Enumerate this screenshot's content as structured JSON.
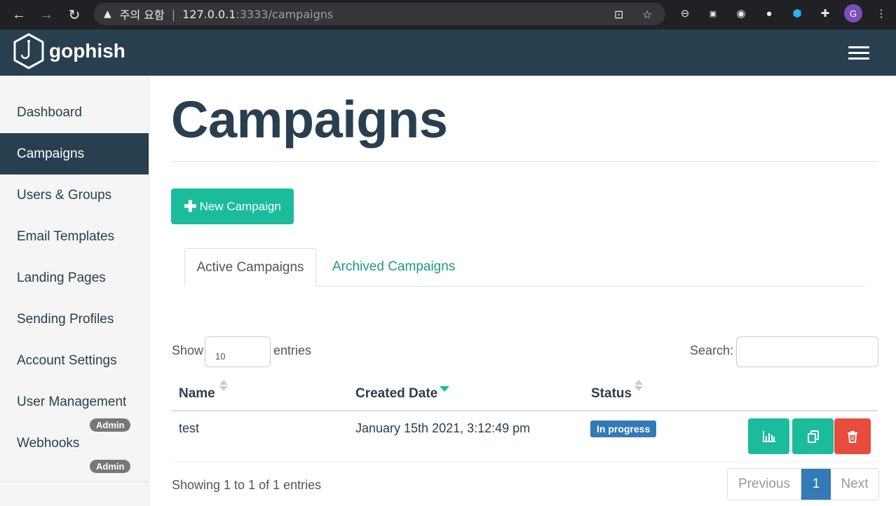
{
  "browser": {
    "security_warning": "주의 요함",
    "url_host": "127.0.0.1",
    "url_path": ":3333/campaigns",
    "profile_initial": "G"
  },
  "app": {
    "brand": "gophish"
  },
  "sidebar": {
    "items": [
      {
        "label": "Dashboard"
      },
      {
        "label": "Campaigns"
      },
      {
        "label": "Users & Groups"
      },
      {
        "label": "Email Templates"
      },
      {
        "label": "Landing Pages"
      },
      {
        "label": "Sending Profiles"
      },
      {
        "label": "Account Settings"
      },
      {
        "label": "User Management"
      },
      {
        "label": "Webhooks"
      }
    ],
    "admin_badge": "Admin"
  },
  "main": {
    "title": "Campaigns",
    "new_button": "New Campaign",
    "tabs": [
      {
        "label": "Active Campaigns"
      },
      {
        "label": "Archived Campaigns"
      }
    ],
    "length": {
      "show": "Show",
      "value": "10",
      "entries": "entries"
    },
    "search_label": "Search:",
    "table": {
      "headers": [
        "Name",
        "Created Date",
        "Status"
      ],
      "rows": [
        {
          "name": "test",
          "created": "January 15th 2021, 3:12:49 pm",
          "status": "In progress"
        }
      ]
    },
    "info": "Showing 1 to 1 of 1 entries",
    "pager": {
      "previous": "Previous",
      "current": "1",
      "next": "Next"
    }
  },
  "colors": {
    "navy": "#283f50",
    "teal": "#1abc9c",
    "blue": "#337ab7",
    "red": "#e74c3c"
  }
}
